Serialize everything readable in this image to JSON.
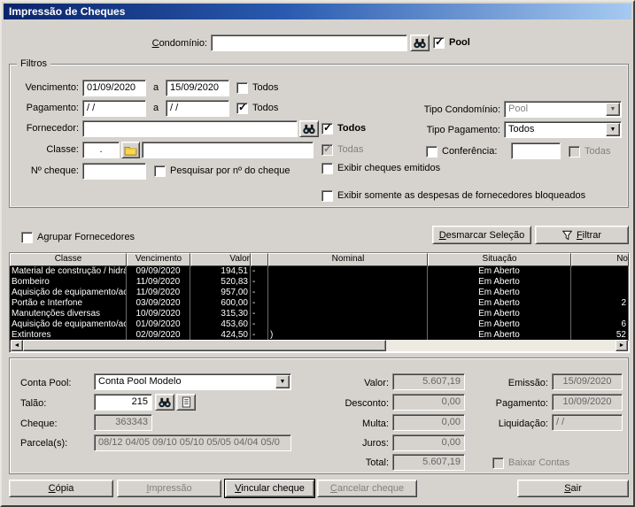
{
  "window": {
    "title": "Impressão de Cheques"
  },
  "header": {
    "condominio_label": "Condomínio:",
    "condominio_value": "",
    "pool_label": "Pool",
    "pool_checked": true
  },
  "filtros": {
    "title": "Filtros",
    "entre_label": "a",
    "vencimento_label": "Vencimento:",
    "vencimento_de": "01/09/2020",
    "vencimento_ate": "15/09/2020",
    "vencimento_todos_label": "Todos",
    "vencimento_todos_checked": false,
    "pagamento_label": "Pagamento:",
    "pagamento_de": "/  /",
    "pagamento_ate": "/  /",
    "pagamento_todos_label": "Todos",
    "pagamento_todos_checked": true,
    "fornecedor_label": "Fornecedor:",
    "fornecedor_value": "",
    "fornecedor_todos_label": "Todos",
    "fornecedor_todos_checked": true,
    "classe_label": "Classe:",
    "classe_codigo": ".",
    "classe_nome": "",
    "classe_todas_label": "Todas",
    "classe_todas_checked": true,
    "ncheque_label": "Nº cheque:",
    "ncheque_value": "",
    "pesquisar_label": "Pesquisar por nº do cheque",
    "pesquisar_checked": false,
    "exibir_emitidos_label": "Exibir cheques emitidos",
    "exibir_emitidos_checked": false,
    "exibir_bloqueados_label": "Exibir somente as despesas de fornecedores bloqueados",
    "exibir_bloqueados_checked": false,
    "tipo_condominio_label": "Tipo Condomínio:",
    "tipo_condominio_value": "Pool",
    "tipo_pagamento_label": "Tipo Pagamento:",
    "tipo_pagamento_value": "Todos",
    "conferencia_label": "Conferência:",
    "conferencia_checked": false,
    "conferencia_value": "",
    "conferencia_todas_label": "Todas",
    "conferencia_todas_checked": false
  },
  "grid_bar": {
    "agrupar_label": "Agrupar Fornecedores",
    "agrupar_checked": false,
    "desmarcar_button": "Desmarcar Seleção",
    "filtrar_button": "Filtrar"
  },
  "table": {
    "columns": [
      "Classe",
      "Vencimento",
      "Valor",
      "",
      "Nominal",
      "Situação",
      "No"
    ],
    "rows": [
      [
        "Material de construção / hidrá",
        "09/09/2020",
        "194,51",
        "-",
        "",
        "Em Aberto",
        ""
      ],
      [
        "Bombeiro",
        "11/09/2020",
        "520,83",
        "-",
        "",
        "Em Aberto",
        ""
      ],
      [
        "Aquisição de equipamento/ace",
        "11/09/2020",
        "957,00",
        "-",
        "",
        "Em Aberto",
        ""
      ],
      [
        "Portão e Interfone",
        "03/09/2020",
        "600,00",
        "-",
        "",
        "Em Aberto",
        "2"
      ],
      [
        "Manutenções diversas",
        "10/09/2020",
        "315,30",
        "-",
        "",
        "Em Aberto",
        ""
      ],
      [
        "Aquisição de equipamento/ace",
        "01/09/2020",
        "453,60",
        "-",
        "",
        "Em Aberto",
        "6"
      ],
      [
        "Extintores",
        "02/09/2020",
        "424,50",
        "-",
        ")",
        "Em Aberto",
        "52"
      ]
    ]
  },
  "detalhes": {
    "conta_pool_label": "Conta Pool:",
    "conta_pool_value": "Conta Pool Modelo",
    "talao_label": "Talão:",
    "talao_value": "215",
    "cheque_label": "Cheque:",
    "cheque_value": "363343",
    "parcelas_label": "Parcela(s):",
    "parcelas_value": "08/12 04/05 09/10 05/10 05/05 04/04 05/0",
    "valor_label": "Valor:",
    "valor_value": "5.607,19",
    "desconto_label": "Desconto:",
    "desconto_value": "0,00",
    "multa_label": "Multa:",
    "multa_value": "0,00",
    "juros_label": "Juros:",
    "juros_value": "0,00",
    "total_label": "Total:",
    "total_value": "5.607,19",
    "emissao_label": "Emissão:",
    "emissao_value": "15/09/2020",
    "pagamento_label": "Pagamento:",
    "pagamento_value": "10/09/2020",
    "liquidacao_label": "Liquidação:",
    "liquidacao_value": "/  /",
    "baixar_contas_label": "Baixar Contas",
    "baixar_contas_checked": false
  },
  "buttons": {
    "copia": "Cópia",
    "impressao": "Impressão",
    "vincular": "Vincular cheque",
    "cancelar": "Cancelar cheque",
    "sair": "Sair"
  },
  "icons": {
    "combo_arrow": "▼",
    "scroll_left": "◄",
    "scroll_right": "►"
  },
  "colors": {
    "titlebar_start": "#0a246a",
    "titlebar_end": "#a6caf0",
    "window_bg": "#d6d3ce",
    "selected_row_bg": "#000000",
    "selected_row_text": "#ffffff"
  }
}
